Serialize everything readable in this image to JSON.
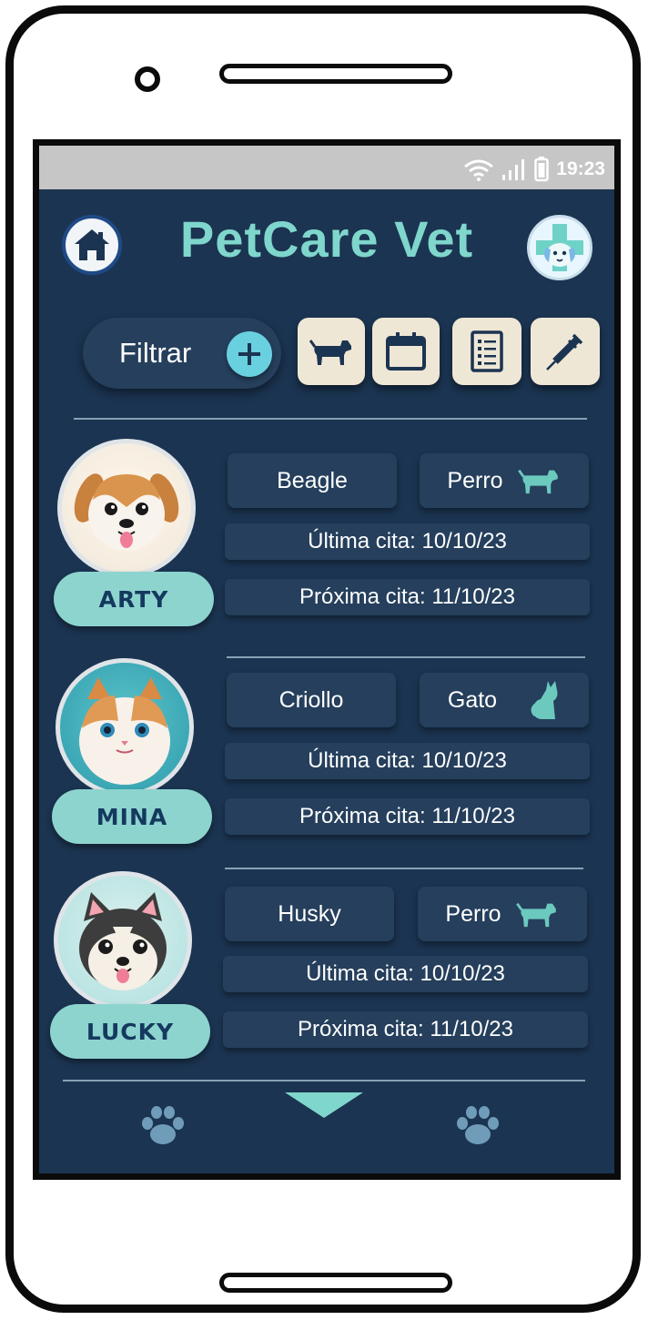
{
  "status_bar": {
    "time": "19:23",
    "icons": [
      "wifi-icon",
      "signal-icon",
      "battery-icon"
    ]
  },
  "header": {
    "title": "PetCare Vet",
    "left_icon": "home-icon",
    "right_icon": "vet-logo-icon"
  },
  "toolbar": {
    "filter_label": "Filtrar",
    "filter_icon": "plus-icon",
    "tools": [
      "dog-filter-icon",
      "calendar-icon",
      "checklist-icon",
      "syringe-icon"
    ]
  },
  "pets": [
    {
      "name": "ARTY",
      "breed": "Beagle",
      "species": "Perro",
      "species_icon": "dog-icon",
      "last_visit": "Última cita: 10/10/23",
      "next_visit": "Próxima cita: 11/10/23"
    },
    {
      "name": "MINA",
      "breed": "Criollo",
      "species": "Gato",
      "species_icon": "cat-icon",
      "last_visit": "Última cita: 10/10/23",
      "next_visit": "Próxima cita: 11/10/23"
    },
    {
      "name": "LUCKY",
      "breed": "Husky",
      "species": "Perro",
      "species_icon": "dog-icon",
      "last_visit": "Última cita: 10/10/23",
      "next_visit": "Próxima cita: 11/10/23"
    }
  ],
  "bottom_nav": {
    "icons": [
      "paw-icon",
      "chevron-down-icon",
      "paw-icon"
    ]
  },
  "colors": {
    "background": "#1b3451",
    "accent": "#7fd6cc",
    "chip": "#253f5c",
    "tool": "#efe7d5",
    "pill": "#8dd4cf"
  }
}
